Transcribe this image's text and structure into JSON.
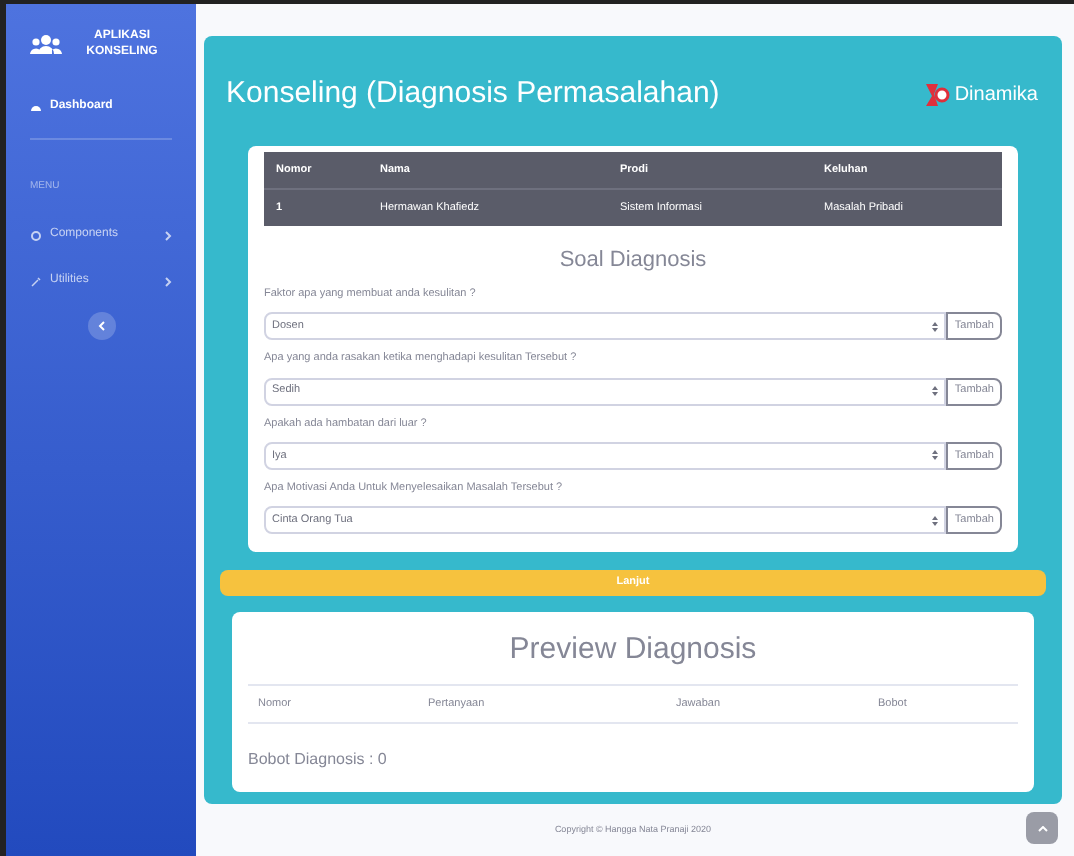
{
  "sidebar": {
    "brand": "APLIKASI KONSELING",
    "items": [
      {
        "label": "Dashboard",
        "selected": true,
        "kind": "link"
      },
      {
        "label": "MENU",
        "kind": "heading"
      },
      {
        "label": "Components",
        "selected": false,
        "kind": "group"
      },
      {
        "label": "Utilities",
        "selected": false,
        "kind": "group"
      }
    ]
  },
  "header": {
    "title": "Konseling (Diagnosis Permasalahan)",
    "logo_text": "Dinamika"
  },
  "student_table": {
    "columns": [
      "Nomor",
      "Nama",
      "Prodi",
      "Keluhan"
    ],
    "rows": [
      [
        "1",
        "Hermawan Khafiedz",
        "Sistem Informasi",
        "Masalah Pribadi"
      ]
    ]
  },
  "questions_title": "Soal Diagnosis",
  "questions": [
    {
      "label": "Faktor apa yang membuat anda kesulitan ?",
      "value": "Dosen",
      "button": "Tambah"
    },
    {
      "label": "Apa yang anda rasakan ketika menghadapi kesulitan Tersebut ?",
      "value": "Sedih",
      "button": "Tambah"
    },
    {
      "label": "Apakah ada hambatan dari luar ?",
      "value": "Iya",
      "button": "Tambah"
    },
    {
      "label": "Apa Motivasi Anda Untuk Menyelesaikan Masalah Tersebut ?",
      "value": "Cinta Orang Tua",
      "button": "Tambah"
    }
  ],
  "next_button": "Lanjut",
  "preview": {
    "title": "Preview Diagnosis",
    "columns": [
      "Nomor",
      "Pertanyaan",
      "Jawaban",
      "Bobot"
    ],
    "total": "Bobot Diagnosis : 0"
  },
  "footer": "Copyright © Hangga Nata Pranaji 2020"
}
